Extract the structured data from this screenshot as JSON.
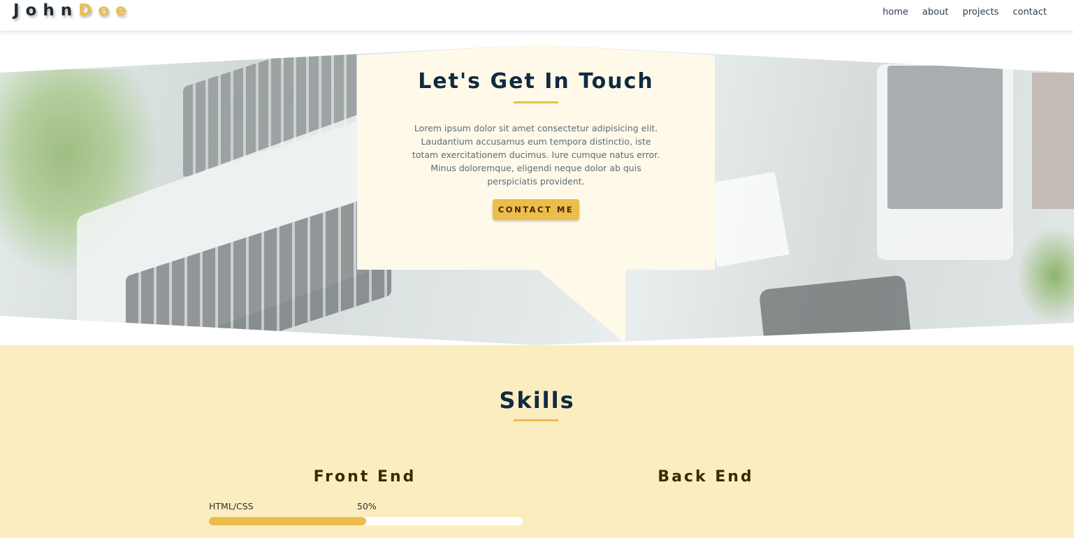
{
  "navbar": {
    "logo_first": "John",
    "logo_last": "Doe",
    "links": [
      "home",
      "about",
      "projects",
      "contact"
    ]
  },
  "hero": {
    "title": "Let's Get In Touch",
    "paragraph": "Lorem ipsum dolor sit amet consectetur adipisicing elit. Laudantium accusamus eum tempora distinctio, iste totam exercitationem ducimus. Iure cumque natus error. Minus doloremque, eligendi neque dolor ab quis perspiciatis provident.",
    "button_label": "CONTACT ME"
  },
  "skills": {
    "title": "Skills",
    "columns": [
      {
        "title": "Front End",
        "items": [
          {
            "label": "HTML/CSS",
            "percent_text": "50%",
            "percent": 50
          }
        ]
      },
      {
        "title": "Back End",
        "items": []
      }
    ]
  },
  "colors": {
    "accent": "#ecbd4c",
    "heading": "#102a40",
    "callout_bg": "#fff9e9",
    "skills_bg": "#fcedc1"
  }
}
